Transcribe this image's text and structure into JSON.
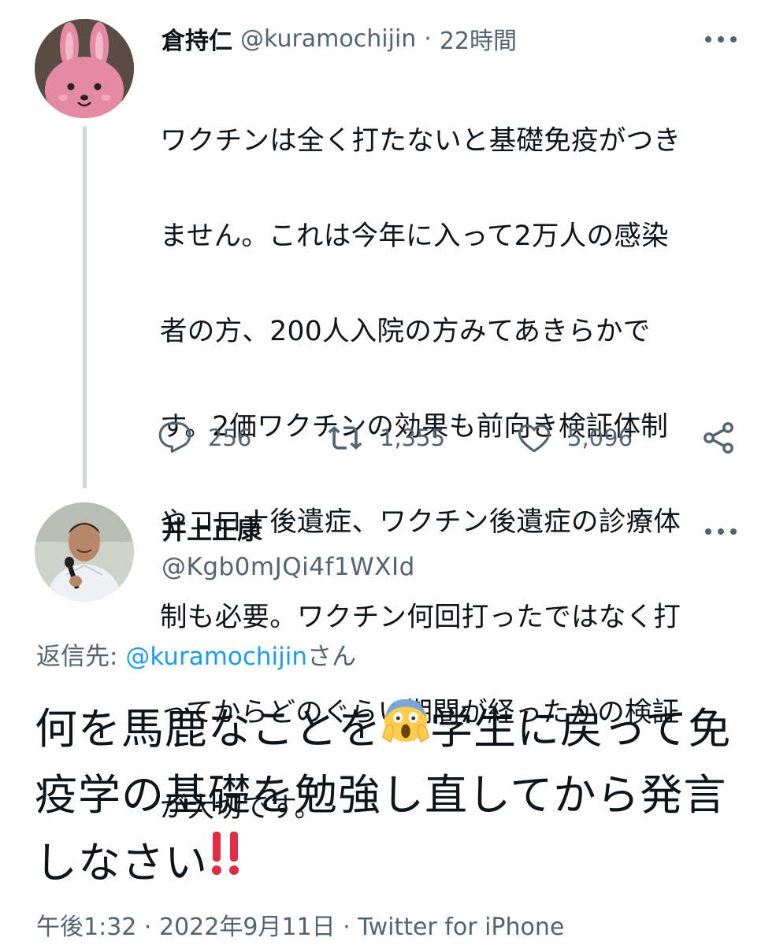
{
  "tweet1": {
    "name": "倉持仁",
    "handle": "@kuramochijin",
    "dot": "·",
    "time": "22時間",
    "lines": [
      "ワクチンは全く打たないと基礎免疫がつき",
      "ません。これは今年に入って2万人の感染",
      "者の方、200人入院の方みてあきらかで",
      "す。2価ワクチンの効果も前向き検証体制",
      "やコロナ後遺症、ワクチン後遺症の診療体",
      "制も必要。ワクチン何回打ったではなく打",
      "ってからどのぐらい期間が経ったかの検証",
      "が大切です。"
    ],
    "reply_count": "256",
    "retweet_count": "1,355",
    "like_count": "5,096"
  },
  "tweet2": {
    "name": "井上正康",
    "handle": "@Kgb0mJQi4f1WXId",
    "reply_to_prefix": "返信先: ",
    "reply_to_handle": "@kuramochijin",
    "reply_to_suffix": "さん",
    "body_part1": "何を馬鹿なことを",
    "body_part2": "学生に戻って免疫学の基礎を勉強し直してから発言しなさい",
    "emoji1": "face-screaming-in-fear",
    "emoji2": "double-exclamation-mark",
    "footer_time": "午後1:32",
    "footer_dot1": " · ",
    "footer_date": "2022年9月11日",
    "footer_dot2": " · ",
    "footer_source": "Twitter for iPhone"
  },
  "colors": {
    "text": "#0f1419",
    "secondary": "#536471",
    "link": "#1d9bf0",
    "thread_line": "#cfd9de"
  }
}
